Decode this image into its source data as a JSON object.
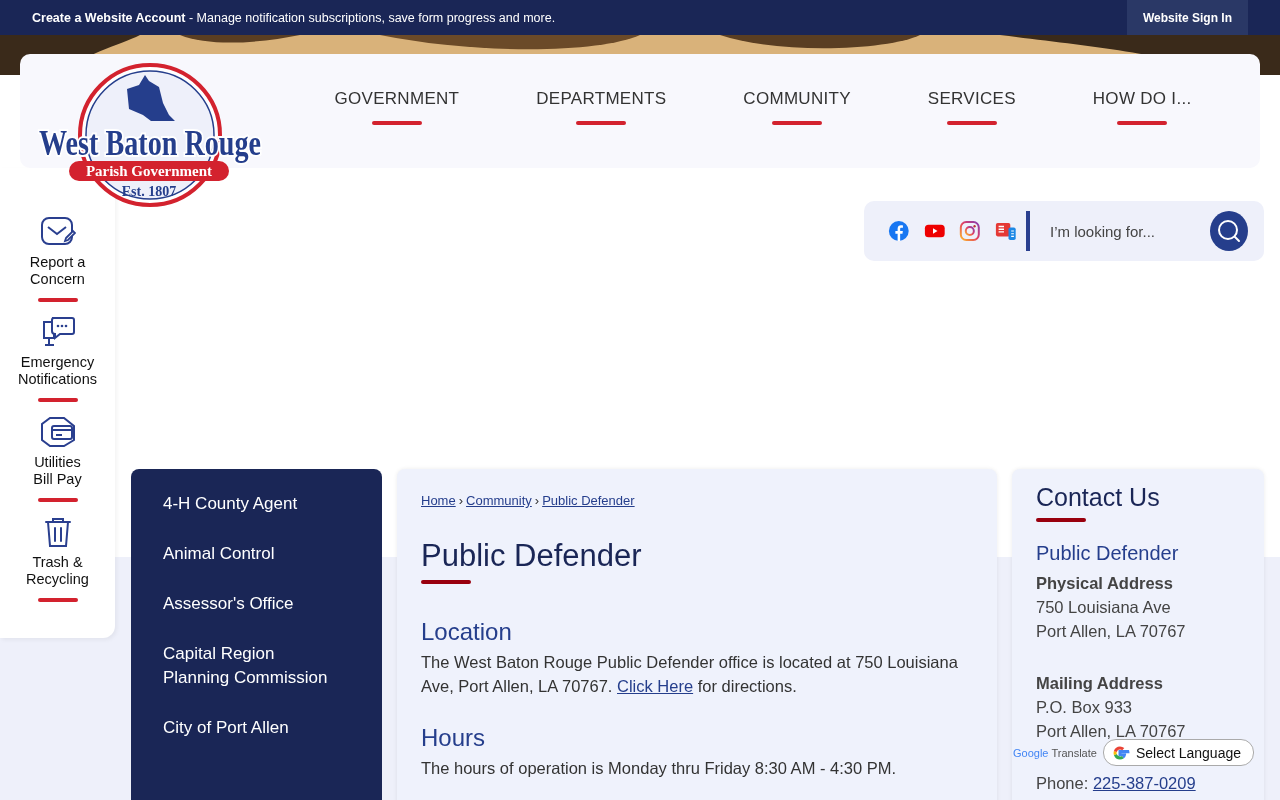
{
  "top_bar": {
    "message_bold": "Create a Website Account",
    "message": " - Manage notification subscriptions, save form progress and more.",
    "sign_in": "Website Sign In"
  },
  "logo": {
    "name": "West Baton Rouge",
    "subtitle": "Parish Government",
    "established": "Est. 1807"
  },
  "nav": [
    "GOVERNMENT",
    "DEPARTMENTS",
    "COMMUNITY",
    "SERVICES",
    "HOW DO I..."
  ],
  "quick_links": [
    {
      "kind": "mail",
      "label": "Report a Concern"
    },
    {
      "kind": "chat",
      "label": "Emergency Notifications"
    },
    {
      "kind": "card",
      "label": "Utilities Bill Pay"
    },
    {
      "kind": "trash",
      "label": "Trash & Recycling"
    }
  ],
  "search": {
    "placeholder": "I’m looking for..."
  },
  "social": [
    {
      "kind": "facebook"
    },
    {
      "kind": "youtube"
    },
    {
      "kind": "instagram"
    },
    {
      "kind": "news"
    }
  ],
  "side_nav": [
    "4-H County Agent",
    "Animal Control",
    "Assessor's Office",
    "Capital Region Planning Commission",
    "City of Port Allen"
  ],
  "breadcrumb": [
    "Home",
    "Community",
    "Public Defender"
  ],
  "breadcrumb_separator": "›",
  "page_title": "Public Defender",
  "sections": [
    {
      "heading": "Location",
      "text_before": "The West Baton Rouge Public Defender office is located at 750 Louisiana Ave, Port Allen, LA 70767. ",
      "link": "Click Here",
      "text_after": " for directions."
    },
    {
      "heading": "Hours",
      "text_before": "The hours of operation is Monday thru Friday 8:30 AM - 4:30 PM."
    }
  ],
  "contact": {
    "title": "Contact Us",
    "name": "Public Defender",
    "groups": [
      {
        "label": "Physical Address",
        "lines": [
          "750 Louisiana Ave",
          "Port Allen, LA 70767"
        ]
      },
      {
        "label": "Mailing Address",
        "lines": [
          "P.O. Box 933",
          "Port Allen, LA 70767"
        ]
      }
    ],
    "phone_label": "Phone: ",
    "phone": "225-387-0209"
  },
  "translate": {
    "button": "Select Language",
    "brand": "Google",
    "label": "Translate"
  }
}
